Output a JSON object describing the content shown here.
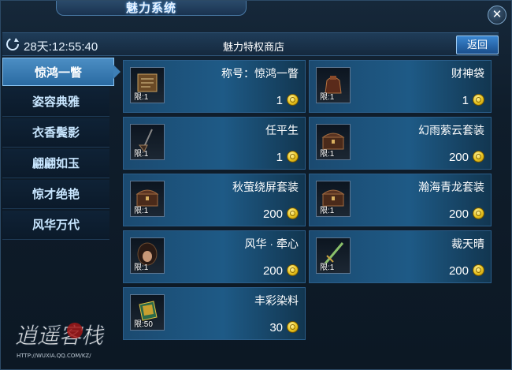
{
  "window": {
    "title": "魅力系统"
  },
  "topbar": {
    "timer": "28天:12:55:40",
    "shop_title": "魅力特权商店",
    "back_label": "返回"
  },
  "sidebar": {
    "items": [
      {
        "label": "惊鸿一瞥",
        "active": true
      },
      {
        "label": "姿容典雅",
        "active": false
      },
      {
        "label": "衣香鬓影",
        "active": false
      },
      {
        "label": "翩翩如玉",
        "active": false
      },
      {
        "label": "惊才绝艳",
        "active": false
      },
      {
        "label": "风华万代",
        "active": false
      }
    ]
  },
  "items": [
    {
      "name": "称号：惊鸿一瞥",
      "limit": "限:1",
      "price": "1",
      "icon": "scroll-icon"
    },
    {
      "name": "财神袋",
      "limit": "限:1",
      "price": "1",
      "icon": "pouch-icon"
    },
    {
      "name": "任平生",
      "limit": "限:1",
      "price": "1",
      "icon": "weapon-icon"
    },
    {
      "name": "幻雨萦云套装",
      "limit": "限:1",
      "price": "200",
      "icon": "chest-icon"
    },
    {
      "name": "秋萤绕屏套装",
      "limit": "限:1",
      "price": "200",
      "icon": "chest-icon"
    },
    {
      "name": "瀚海青龙套装",
      "limit": "限:1",
      "price": "200",
      "icon": "chest-icon"
    },
    {
      "name": "风华 · 牵心",
      "limit": "限:1",
      "price": "200",
      "icon": "hairstyle-icon"
    },
    {
      "name": "裁天晴",
      "limit": "限:1",
      "price": "200",
      "icon": "sword-icon"
    },
    {
      "name": "丰彩染料",
      "limit": "限:50",
      "price": "30",
      "icon": "dye-icon"
    }
  ],
  "watermark": {
    "text": "逍遥客栈",
    "url": "HTTP://WUXIA.QQ.COM/KZ/"
  },
  "colors": {
    "accent": "#2a6aa2",
    "coin": "#e8c21c",
    "card": "#1e5a86"
  }
}
